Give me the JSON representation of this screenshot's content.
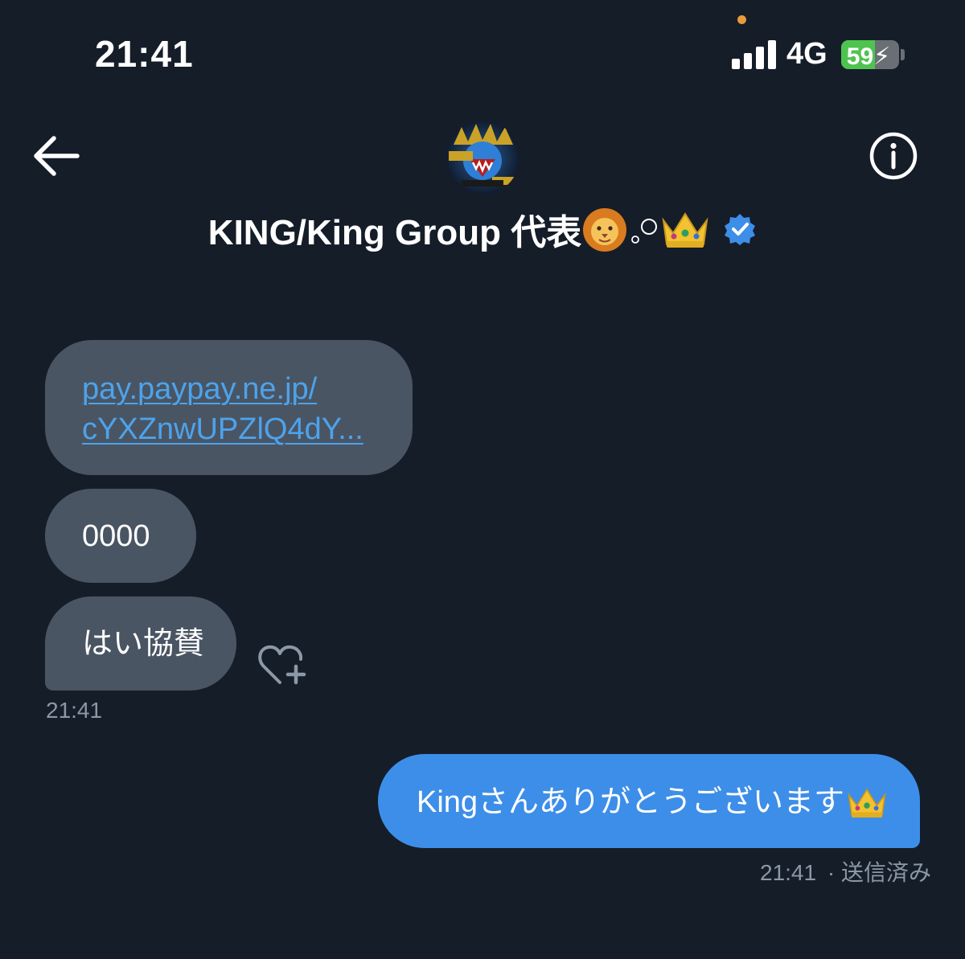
{
  "status_bar": {
    "time": "21:41",
    "network": "4G",
    "battery_level": "59",
    "battery_fraction": 0.59,
    "charging": true,
    "signal_bars": 4
  },
  "header": {
    "contact_name": "KING/King Group 代表",
    "avatar_icon": "avatar-image",
    "back_icon": "back-arrow-icon",
    "info_icon": "info-icon",
    "title_emojis": [
      "lion-emoji",
      "bubbles-emoji",
      "crown-emoji"
    ],
    "verified_icon": "verified-badge-icon"
  },
  "messages": {
    "received": [
      {
        "link_line1": "pay.paypay.ne.jp/",
        "link_line2": "cYXZnwUPZlQ4dY..."
      },
      {
        "text": "0000"
      },
      {
        "text": "はい協賛"
      }
    ],
    "received_time": "21:41",
    "reaction_icon": "add-reaction-heart-icon",
    "sent": [
      {
        "text": "Kingさんありがとうございます"
      }
    ],
    "sent_time": "21:41",
    "sent_status": "· 送信済み"
  },
  "colors": {
    "background": "#151d29",
    "received_bubble": "#4a5563",
    "sent_bubble": "#3d8ee8",
    "link": "#4ca3ec",
    "meta_text": "#8b98a5",
    "verified": "#3d8ee8",
    "battery_fill": "#4fc34f"
  }
}
